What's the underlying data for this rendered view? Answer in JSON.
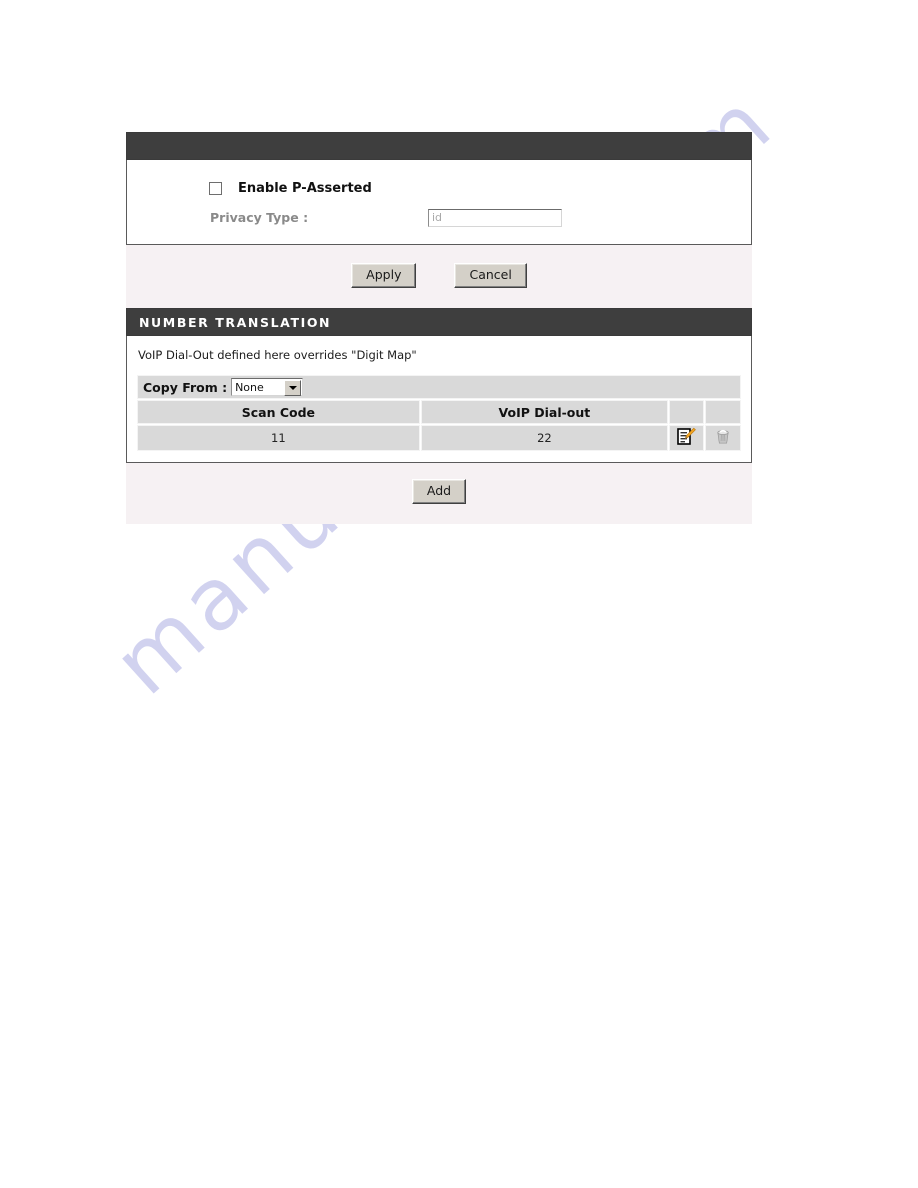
{
  "watermark": {
    "text": "manualshive.com"
  },
  "p_asserted_section": {
    "header_title": "",
    "checkbox": {
      "label": "Enable P-Asserted",
      "checked": false
    },
    "privacy_type": {
      "label": "Privacy Type :",
      "value": "id",
      "placeholder": "id"
    },
    "buttons": {
      "apply_label": "Apply",
      "cancel_label": "Cancel"
    }
  },
  "number_translation": {
    "header_title": "NUMBER TRANSLATION",
    "note": "VoIP Dial-Out defined here overrides \"Digit Map\"",
    "copy_from": {
      "label": "Copy From :",
      "selected": "None",
      "options": [
        "None"
      ]
    },
    "table": {
      "columns": [
        "Scan Code",
        "VoIP Dial-out",
        "",
        ""
      ],
      "rows": [
        {
          "scan_code": "11",
          "voip_dial_out": "22"
        }
      ],
      "row_actions": {
        "edit_icon": "edit-note-icon",
        "delete_icon": "trash-icon"
      }
    },
    "add_button_label": "Add"
  },
  "colors": {
    "header_bar": "#3e3e3e",
    "panel_background": "#f6f1f3",
    "table_header": "#d3d3d3",
    "table_row": "#e0e0e0",
    "button_face": "#d4d0c8",
    "watermark": "#b9bbe8",
    "pencil_accent": "#f5a623"
  }
}
